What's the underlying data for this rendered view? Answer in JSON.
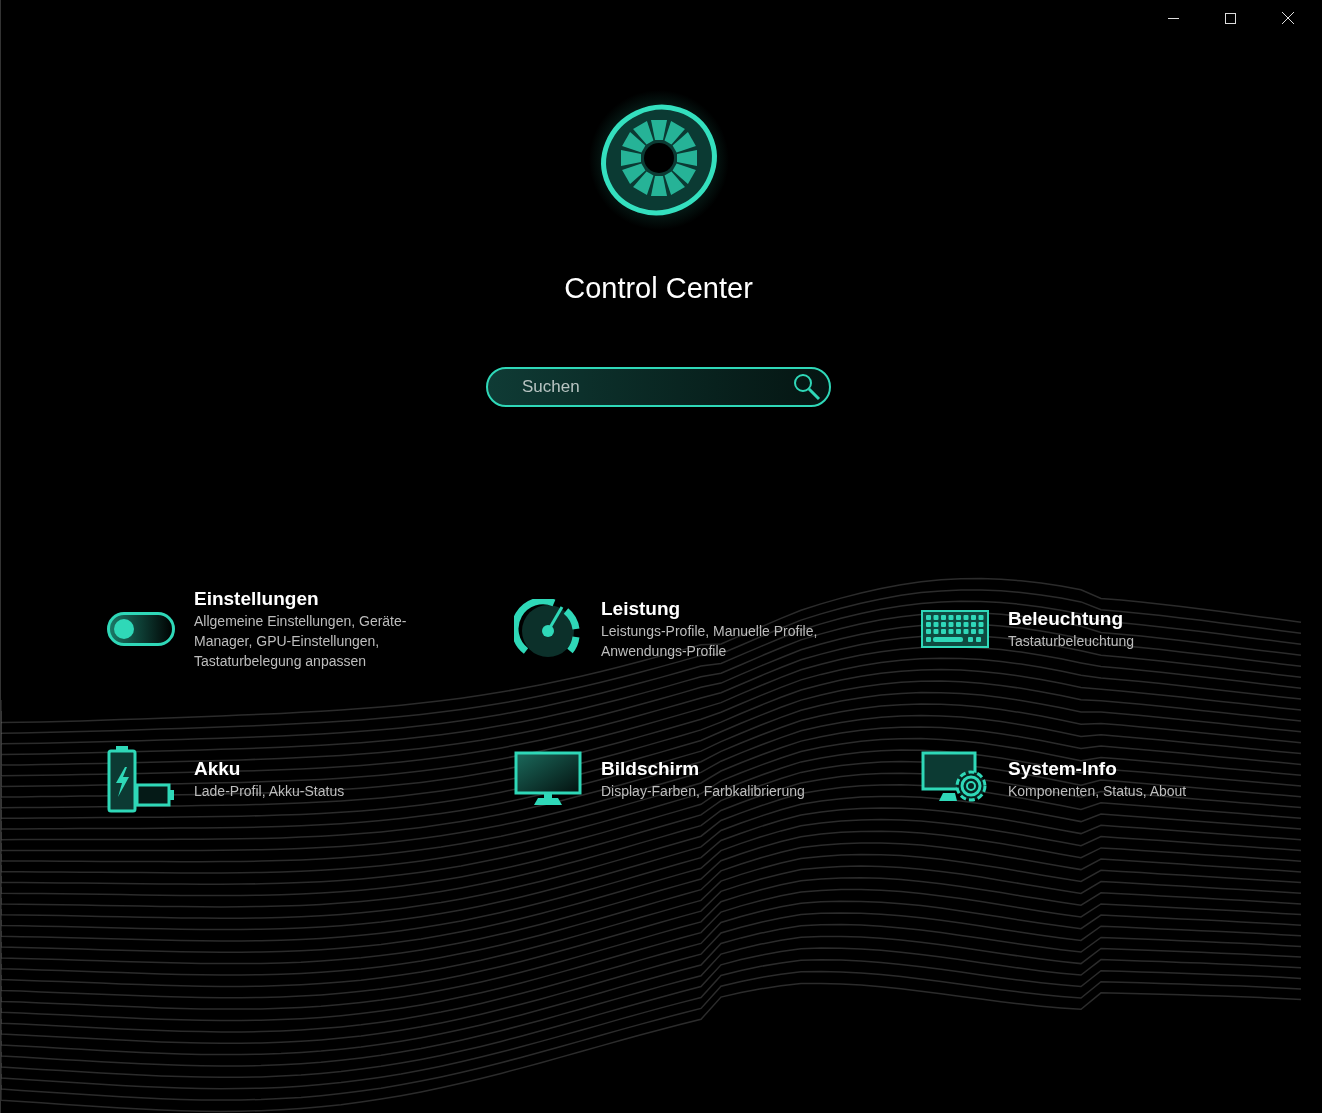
{
  "window": {
    "title": "Control Center"
  },
  "search": {
    "placeholder": "Suchen"
  },
  "items": [
    {
      "kind": "toggle",
      "title": "Einstellungen",
      "description": "Allgemeine Einstellungen, Geräte-Manager, GPU-Einstellungen, Tastaturbelegung anpassen"
    },
    {
      "kind": "gauge",
      "title": "Leistung",
      "description": "Leistungs-Profile, Manuelle Profile, Anwendungs-Profile"
    },
    {
      "kind": "keyboard",
      "title": "Beleuchtung",
      "description": "Tastaturbeleuchtung"
    },
    {
      "kind": "battery",
      "title": "Akku",
      "description": "Lade-Profil, Akku-Status"
    },
    {
      "kind": "monitor",
      "title": "Bildschirm",
      "description": "Display-Farben, Farbkalibrierung"
    },
    {
      "kind": "system",
      "title": "System-Info",
      "description": "Komponenten, Status, About"
    }
  ]
}
